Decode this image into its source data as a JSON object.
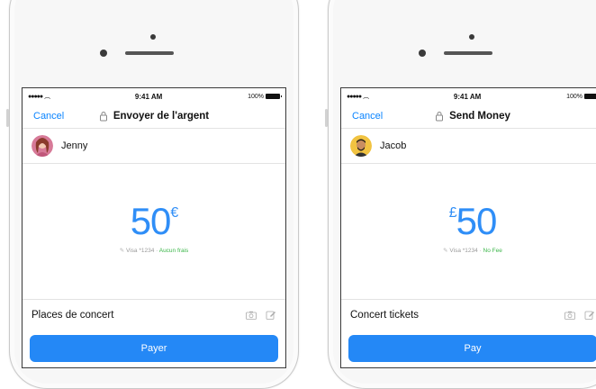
{
  "phones": [
    {
      "status": {
        "time": "9:41 AM",
        "battery": "100%"
      },
      "nav": {
        "cancel": "Cancel",
        "title": "Envoyer de l'argent"
      },
      "recipient": {
        "name": "Jenny",
        "avatar_color": "#c0577a"
      },
      "amount": {
        "value": "50",
        "currency": "€",
        "currency_position": "after"
      },
      "payment": {
        "card": "Visa *1234",
        "separator": " · ",
        "fee": "Aucun frais"
      },
      "note": "Places de concert",
      "pay_button": "Payer"
    },
    {
      "status": {
        "time": "9:41 AM",
        "battery": "100%"
      },
      "nav": {
        "cancel": "Cancel",
        "title": "Send Money"
      },
      "recipient": {
        "name": "Jacob",
        "avatar_color": "#e8b33a"
      },
      "amount": {
        "value": "50",
        "currency": "£",
        "currency_position": "before"
      },
      "payment": {
        "card": "Visa *1234",
        "separator": " · ",
        "fee": "No Fee"
      },
      "note": "Concert tickets",
      "pay_button": "Pay"
    }
  ],
  "colors": {
    "accent": "#2488f6",
    "amount": "#2f8ef7",
    "fee": "#3cb64a",
    "cancel": "#0a84ff"
  },
  "icons": [
    "signal-icon",
    "wifi-icon",
    "battery-icon",
    "lock-icon",
    "pencil-icon",
    "camera-icon",
    "compose-icon"
  ]
}
